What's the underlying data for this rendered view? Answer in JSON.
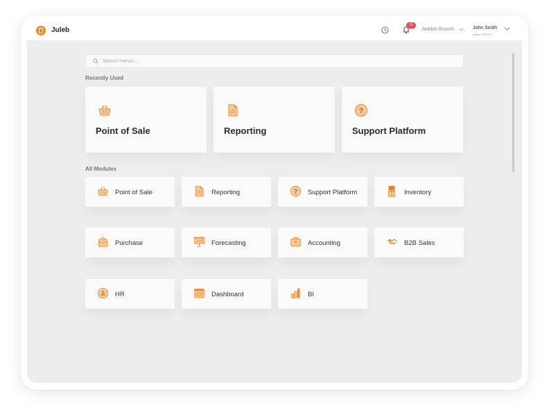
{
  "app": {
    "name": "Juleb"
  },
  "header": {
    "notification_count": "11",
    "branch": "Jeddah Branch",
    "user_name": "John Smith",
    "user_sub": "Admin-xRE001"
  },
  "search": {
    "placeholder": "Search menus..."
  },
  "recently_used": {
    "title": "Recently Used",
    "items": [
      {
        "label": "Point of Sale",
        "icon": "basket-icon"
      },
      {
        "label": "Reporting",
        "icon": "document-icon"
      },
      {
        "label": "Support Platform",
        "icon": "question-icon"
      }
    ]
  },
  "all_modules": {
    "title": "All Modules",
    "items": [
      {
        "label": "Point of Sale",
        "icon": "basket-icon"
      },
      {
        "label": "Reporting",
        "icon": "document-icon"
      },
      {
        "label": "Support Platform",
        "icon": "question-icon"
      },
      {
        "label": "Inventory",
        "icon": "boxes-icon"
      },
      {
        "label": "Purchase",
        "icon": "bag-icon"
      },
      {
        "label": "Forecasting",
        "icon": "presentation-icon"
      },
      {
        "label": "Accounting",
        "icon": "briefcase-icon"
      },
      {
        "label": "B2B Sales",
        "icon": "handshake-icon"
      },
      {
        "label": "HR",
        "icon": "person-icon"
      },
      {
        "label": "Dashboard",
        "icon": "dashboard-icon"
      },
      {
        "label": "BI",
        "icon": "bar-chart-icon"
      }
    ]
  },
  "colors": {
    "accent": "#ef8a2c",
    "accent_light": "#f8c99a",
    "badge": "#e84d4d",
    "background": "#ededed"
  }
}
